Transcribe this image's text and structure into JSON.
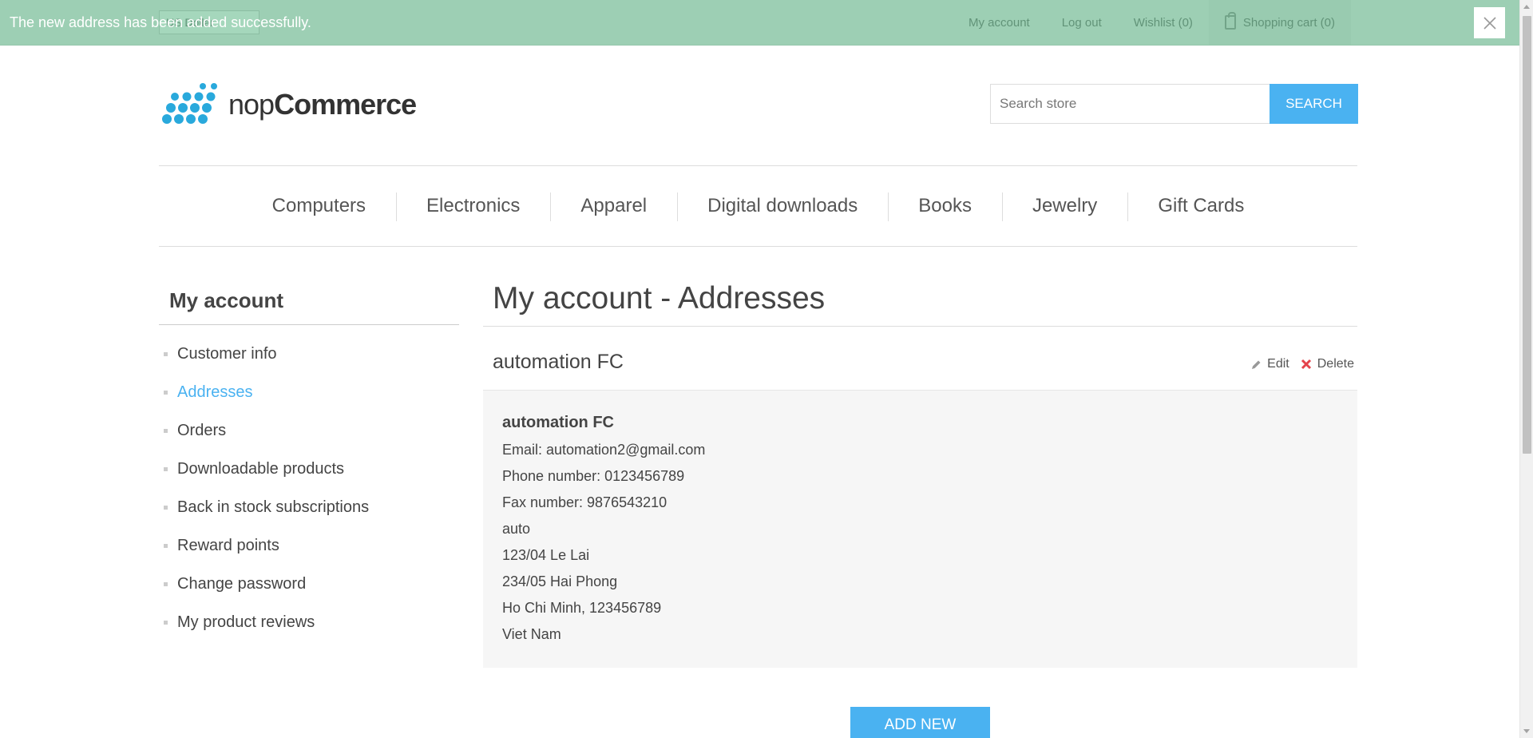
{
  "header": {
    "currency_value": "US Dollar",
    "links": {
      "my_account": "My account",
      "log_out": "Log out",
      "wishlist": "Wishlist (0)",
      "cart": "Shopping cart (0)"
    }
  },
  "notification": {
    "message": "The new address has been added successfully."
  },
  "logo": {
    "text_light": "nop",
    "text_bold": "Commerce"
  },
  "search": {
    "placeholder": "Search store",
    "button_label": "SEARCH"
  },
  "menu": {
    "items": [
      "Computers",
      "Electronics",
      "Apparel",
      "Digital downloads",
      "Books",
      "Jewelry",
      "Gift Cards"
    ]
  },
  "sidebar": {
    "title": "My account",
    "items": [
      {
        "label": "Customer info"
      },
      {
        "label": "Addresses"
      },
      {
        "label": "Orders"
      },
      {
        "label": "Downloadable products"
      },
      {
        "label": "Back in stock subscriptions"
      },
      {
        "label": "Reward points"
      },
      {
        "label": "Change password"
      },
      {
        "label": "My product reviews"
      }
    ],
    "active_label": "Addresses"
  },
  "main": {
    "title": "My account - Addresses",
    "address": {
      "title": "automation FC",
      "edit_label": "Edit",
      "delete_label": "Delete",
      "name": "automation FC",
      "lines": [
        "Email: automation2@gmail.com",
        "Phone number: 0123456789",
        "Fax number: 9876543210",
        "auto",
        "123/04 Le Lai",
        "234/05 Hai Phong",
        "Ho Chi Minh, 123456789",
        "Viet Nam"
      ]
    },
    "add_new_label": "ADD NEW"
  },
  "colors": {
    "accent": "#4ab2f1",
    "notification": "#4bb07a",
    "delete": "#e4434b"
  }
}
